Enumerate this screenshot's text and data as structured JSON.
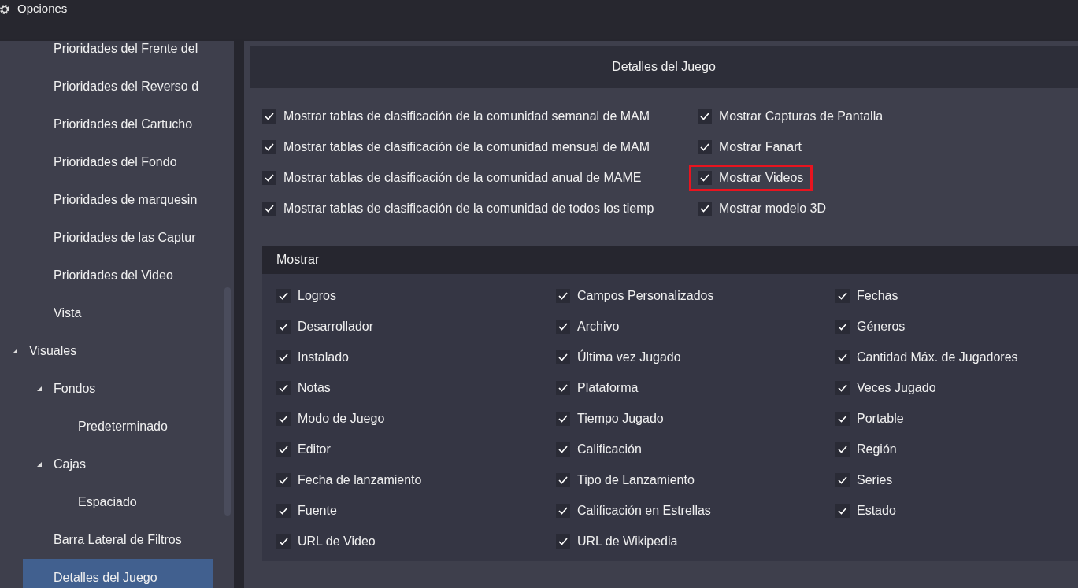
{
  "window": {
    "title": "Opciones"
  },
  "sidebar": {
    "scrolled_items": [
      {
        "label": "Prioridades del Frente del",
        "selected": false
      },
      {
        "label": "Prioridades del Reverso d",
        "selected": false
      },
      {
        "label": "Prioridades del Cartucho",
        "selected": false
      },
      {
        "label": "Prioridades del Fondo",
        "selected": false
      },
      {
        "label": "Prioridades de marquesin",
        "selected": false
      },
      {
        "label": "Prioridades de las Captur",
        "selected": false
      },
      {
        "label": "Prioridades del Video",
        "selected": false
      },
      {
        "label": "Vista",
        "selected": false
      }
    ],
    "tree": [
      {
        "label": "Visuales",
        "selected": false,
        "expanded": true,
        "children": [
          {
            "label": "Fondos",
            "selected": false,
            "expanded": true,
            "children": [
              {
                "label": "Predeterminado",
                "selected": false
              }
            ]
          },
          {
            "label": "Cajas",
            "selected": false,
            "expanded": true,
            "children": [
              {
                "label": "Espaciado",
                "selected": false
              }
            ]
          },
          {
            "label": "Barra Lateral de Filtros",
            "selected": false
          },
          {
            "label": "Detalles del Juego",
            "selected": true
          }
        ]
      }
    ]
  },
  "panel": {
    "title": "Detalles del Juego",
    "options_left": [
      {
        "label": "Mostrar tablas de clasificación de la comunidad semanal de MAM",
        "checked": true
      },
      {
        "label": "Mostrar tablas de clasificación de la comunidad mensual de MAM",
        "checked": true
      },
      {
        "label": "Mostrar tablas de clasificación de la comunidad anual de MAME",
        "checked": true
      },
      {
        "label": "Mostrar tablas de clasificación de la comunidad de todos los tiemp",
        "checked": true
      }
    ],
    "options_right": [
      {
        "label": "Mostrar Capturas de Pantalla",
        "checked": true,
        "highlighted": false
      },
      {
        "label": "Mostrar Fanart",
        "checked": true,
        "highlighted": false
      },
      {
        "label": "Mostrar Videos",
        "checked": true,
        "highlighted": true
      },
      {
        "label": "Mostrar modelo 3D",
        "checked": true,
        "highlighted": false
      }
    ],
    "group": {
      "title": "Mostrar",
      "columns": [
        [
          {
            "label": "Logros",
            "checked": true
          },
          {
            "label": "Desarrollador",
            "checked": true
          },
          {
            "label": "Instalado",
            "checked": true
          },
          {
            "label": "Notas",
            "checked": true
          },
          {
            "label": "Modo de Juego",
            "checked": true
          },
          {
            "label": "Editor",
            "checked": true
          },
          {
            "label": "Fecha de lanzamiento",
            "checked": true
          },
          {
            "label": "Fuente",
            "checked": true
          },
          {
            "label": "URL de Video",
            "checked": true
          }
        ],
        [
          {
            "label": "Campos Personalizados",
            "checked": true
          },
          {
            "label": "Archivo",
            "checked": true
          },
          {
            "label": "Última vez Jugado",
            "checked": true
          },
          {
            "label": "Plataforma",
            "checked": true
          },
          {
            "label": "Tiempo Jugado",
            "checked": true
          },
          {
            "label": "Calificación",
            "checked": true
          },
          {
            "label": "Tipo de Lanzamiento",
            "checked": true
          },
          {
            "label": "Calificación en Estrellas",
            "checked": true
          },
          {
            "label": "URL de Wikipedia",
            "checked": true
          }
        ],
        [
          {
            "label": "Fechas",
            "checked": true
          },
          {
            "label": "Géneros",
            "checked": true
          },
          {
            "label": "Cantidad Máx. de Jugadores",
            "checked": true
          },
          {
            "label": "Veces Jugado",
            "checked": true
          },
          {
            "label": "Portable",
            "checked": true
          },
          {
            "label": "Región",
            "checked": true
          },
          {
            "label": "Series",
            "checked": true
          },
          {
            "label": "Estado",
            "checked": true
          }
        ]
      ]
    }
  }
}
